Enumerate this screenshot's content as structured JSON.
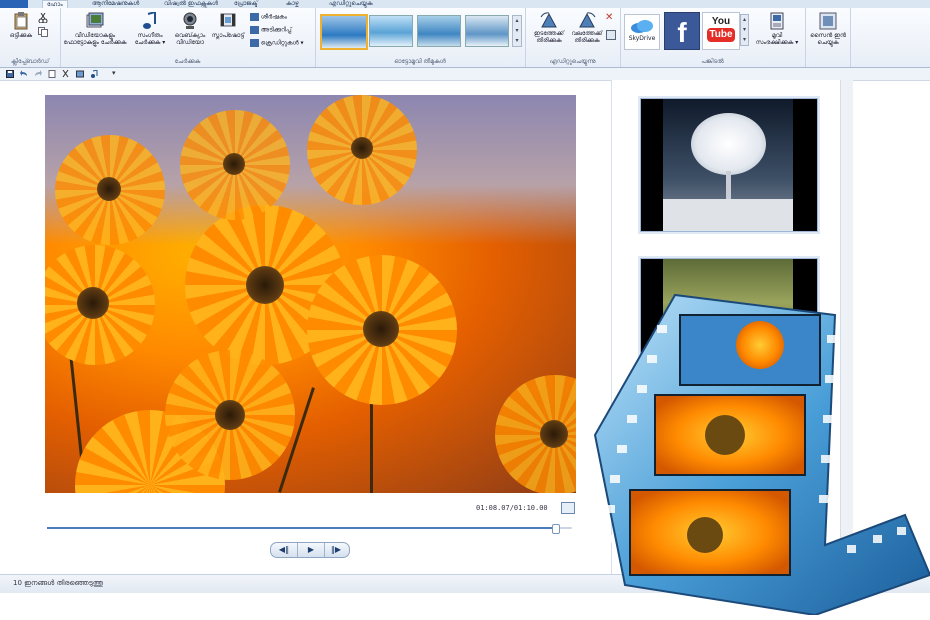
{
  "tabs": {
    "file_label": "",
    "home_label": "ഹോം",
    "items": [
      "ആനിമേഷനുകൾ",
      "വിഷ്വൽ ഇഫക്റ്റുകൾ",
      "പ്രോജക്ട്",
      "കാഴ്ച",
      "എഡിറ്റുചെയ്യുക"
    ]
  },
  "ribbon": {
    "paste_label": "ഒട്ടിക്കുക",
    "clipboard_group": "ക്ലിപ്പ്ബോർഡ്",
    "add_videos_label": "വീഡിയോകളും ഫോട്ടോകളും ചേർക്കുക",
    "add_music_label": "സംഗീതം ചേർക്കുക ▾",
    "webcam_label": "വെബ്‌ക്യാം വീഡിയോ",
    "snapshot_label": "സ്നാപ്ഷോട്ട്",
    "title_label": "ശീർഷകം",
    "caption_label": "അടിക്കുറിപ്പ്",
    "credits_label": "ക്രെഡിറ്റുകൾ ▾",
    "add_group": "ചേർക്കുക",
    "autothemes_group": "ഓട്ടോമൂവി തീമുകൾ",
    "rotate_left_label": "ഇടത്തേക്ക് തിരിക്കുക",
    "rotate_right_label": "വലത്തേക്ക് തിരിക്കുക",
    "editing_group": "എഡിറ്റുചെയ്യുന്നു",
    "skydrive_label": "SkyDrive",
    "youtube_label": "You Tube",
    "share_group": "പങ്കിടൽ",
    "save_movie_label": "മൂവി സംരക്ഷിക്കുക ▾",
    "signin_label": "സൈൻ ഇൻ ചെയ്യുക"
  },
  "player": {
    "time": "01:08.07/01:10.00",
    "progress": 0.97,
    "prev_icon": "previous-frame-icon",
    "play_icon": "play-icon",
    "next_icon": "next-frame-icon"
  },
  "status": {
    "selection": "10 ഇനങ്ങൾ തിരഞ്ഞെടുത്തു"
  },
  "colors": {
    "accent": "#2a64b6",
    "facebook": "#3b5998",
    "youtube_red": "#e52d27"
  }
}
